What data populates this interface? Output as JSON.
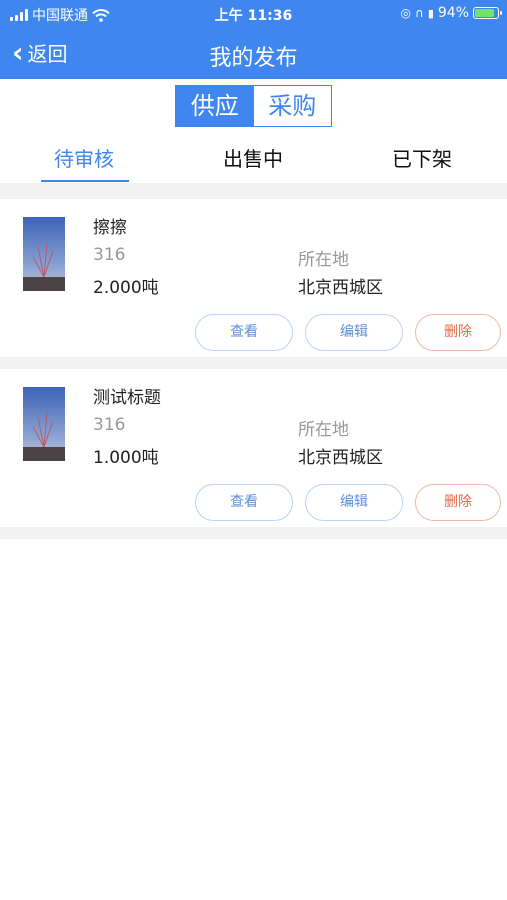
{
  "status_bar": {
    "carrier": "中国联通",
    "time": "上午 11:36",
    "battery": "94%"
  },
  "nav": {
    "back_label": "返回",
    "title": "我的发布"
  },
  "segment": {
    "options": [
      "供应",
      "采购"
    ],
    "selected": "供应"
  },
  "tabs": [
    {
      "label": "待审核",
      "active": true
    },
    {
      "label": "出售中",
      "active": false
    },
    {
      "label": "已下架",
      "active": false
    }
  ],
  "listings": [
    {
      "title": "擦擦",
      "code": "316",
      "quantity": "2.000吨",
      "location_label": "所在地",
      "location": "北京西城区",
      "actions": {
        "view": "查看",
        "edit": "编辑",
        "delete": "删除"
      }
    },
    {
      "title": "测试标题",
      "code": "316",
      "quantity": "1.000吨",
      "location_label": "所在地",
      "location": "北京西城区",
      "actions": {
        "view": "查看",
        "edit": "编辑",
        "delete": "删除"
      }
    }
  ],
  "colors": {
    "primary": "#3f86ee",
    "delete": "#e46a47",
    "background_gap": "#f2f2f2"
  }
}
